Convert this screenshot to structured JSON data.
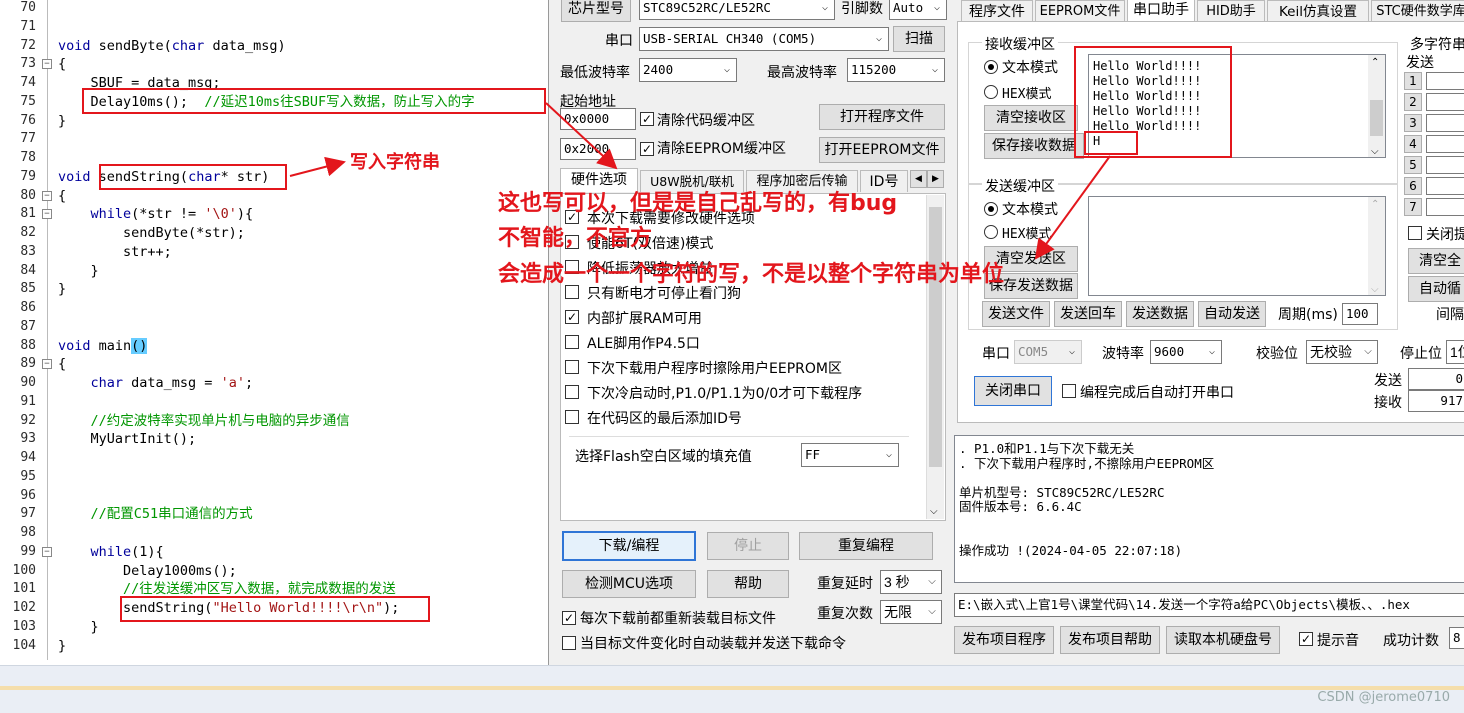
{
  "editor": {
    "lines": [
      {
        "n": "70",
        "html": ""
      },
      {
        "n": "71",
        "html": ""
      },
      {
        "n": "72",
        "html": "<span class='kw'>void</span> sendByte(<span class='kw'>char</span> data_msg)"
      },
      {
        "n": "73",
        "html": "{",
        "fold": "-"
      },
      {
        "n": "74",
        "html": "    SBUF = data_msg;"
      },
      {
        "n": "75",
        "html": "    Delay10ms();  <span class='cm'>//延迟10ms往SBUF写入数据，防止写入的字</span>"
      },
      {
        "n": "76",
        "html": "}"
      },
      {
        "n": "77",
        "html": ""
      },
      {
        "n": "78",
        "html": ""
      },
      {
        "n": "79",
        "html": "<span class='kw'>void</span> sendString(<span class='kw'>char</span>* str)"
      },
      {
        "n": "80",
        "html": "{",
        "fold": "-"
      },
      {
        "n": "81",
        "html": "    <span class='kw'>while</span>(*str != <span class='str'>'\\0'</span>){",
        "fold": "-"
      },
      {
        "n": "82",
        "html": "        sendByte(*str);"
      },
      {
        "n": "83",
        "html": "        str++;"
      },
      {
        "n": "84",
        "html": "    }"
      },
      {
        "n": "85",
        "html": "}"
      },
      {
        "n": "86",
        "html": ""
      },
      {
        "n": "87",
        "html": ""
      },
      {
        "n": "88",
        "html": "<span class='kw'>void</span> main<span class='hl'>()</span>"
      },
      {
        "n": "89",
        "html": "{",
        "fold": "-"
      },
      {
        "n": "90",
        "html": "    <span class='kw'>char</span> data_msg = <span class='str'>'a'</span>;"
      },
      {
        "n": "91",
        "html": ""
      },
      {
        "n": "92",
        "html": "    <span class='cm'>//约定波特率实现单片机与电脑的异步通信</span>"
      },
      {
        "n": "93",
        "html": "    MyUartInit();"
      },
      {
        "n": "94",
        "html": ""
      },
      {
        "n": "95",
        "html": ""
      },
      {
        "n": "96",
        "html": ""
      },
      {
        "n": "97",
        "html": "    <span class='cm'>//配置C51串口通信的方式</span>"
      },
      {
        "n": "98",
        "html": ""
      },
      {
        "n": "99",
        "html": "    <span class='kw'>while</span>(1){",
        "fold": "-"
      },
      {
        "n": "100",
        "html": "        Delay1000ms();"
      },
      {
        "n": "101",
        "html": "        <span class='cm'>//往发送缓冲区写入数据，就完成数据的发送</span>"
      },
      {
        "n": "102",
        "html": "        sendString(<span class='str'>\"Hello World!!!!\\r\\n\"</span>);"
      },
      {
        "n": "103",
        "html": "    }"
      },
      {
        "n": "104",
        "html": "}"
      }
    ]
  },
  "isp": {
    "chip_label": "芯片型号",
    "chip_value": "STC89C52RC/LE52RC",
    "pins_label": "引脚数",
    "pins_value": "Auto",
    "port_label": "串口",
    "port_value": "USB-SERIAL CH340 (COM5)",
    "scan_btn": "扫描",
    "min_baud_label": "最低波特率",
    "min_baud_value": "2400",
    "max_baud_label": "最高波特率",
    "max_baud_value": "115200",
    "start_addr_label": "起始地址",
    "addr1": "0x0000",
    "addr2": "0x2000",
    "clear_code": "清除代码缓冲区",
    "clear_eeprom": "清除EEPROM缓冲区",
    "open_prog": "打开程序文件",
    "open_eeprom": "打开EEPROM文件",
    "left_tabs": [
      "硬件选项",
      "U8W脱机/联机",
      "程序加密后传输",
      "ID号"
    ],
    "options": [
      {
        "label": "本次下载需要修改硬件选项",
        "checked": true
      },
      {
        "label": "使能6T(双倍速)模式",
        "checked": false
      },
      {
        "label": "降低振荡器放大增益",
        "checked": false
      },
      {
        "label": "只有断电才可停止看门狗",
        "checked": false
      },
      {
        "label": "内部扩展RAM可用",
        "checked": true
      },
      {
        "label": "ALE脚用作P4.5口",
        "checked": false
      },
      {
        "label": "下次下载用户程序时擦除用户EEPROM区",
        "checked": false
      },
      {
        "label": "下次冷启动时,P1.0/P1.1为0/0才可下载程序",
        "checked": false
      },
      {
        "label": "在代码区的最后添加ID号",
        "checked": false
      }
    ],
    "fill_label": "选择Flash空白区域的填充值",
    "fill_value": "FF",
    "download_btn": "下载/编程",
    "stop_btn": "停止",
    "reprog_btn": "重复编程",
    "check_mcu_btn": "检测MCU选项",
    "help_btn": "帮助",
    "repeat_delay_label": "重复延时",
    "repeat_delay_value": "3 秒",
    "repeat_count_label": "重复次数",
    "repeat_count_value": "无限",
    "reload_before": "每次下载前都重新装载目标文件",
    "auto_load": "当目标文件变化时自动装载并发送下载命令",
    "right_tabs": [
      "程序文件",
      "EEPROM文件",
      "串口助手",
      "HID助手",
      "Keil仿真设置",
      "STC硬件数学库"
    ],
    "recv_title": "接收缓冲区",
    "text_mode": "文本模式",
    "hex_mode": "HEX模式",
    "clear_recv": "清空接收区",
    "save_recv": "保存接收数据",
    "recv_lines": [
      "Hello World!!!!",
      "Hello World!!!!",
      "Hello World!!!!",
      "Hello World!!!!",
      "Hello World!!!!",
      "H"
    ],
    "send_title": "发送缓冲区",
    "clear_send": "清空发送区",
    "save_send": "保存发送数据",
    "send_file": "发送文件",
    "send_return": "发送回车",
    "send_data": "发送数据",
    "auto_send": "自动发送",
    "period_label": "周期(ms)",
    "period_value": "100",
    "multi_title": "多字符串",
    "multi_send": "发送",
    "multi_rows": [
      "1",
      "2",
      "3",
      "4",
      "5",
      "6",
      "7"
    ],
    "close_hint": "关闭提",
    "clear_all": "清空全",
    "auto_loop": "自动循",
    "interval": "间隔",
    "com_label": "串口",
    "com_value": "COM5",
    "baud_label": "波特率",
    "baud_value": "9600",
    "parity_label": "校验位",
    "parity_value": "无校验",
    "stopbit_label": "停止位",
    "stopbit_value": "1位",
    "close_port": "关闭串口",
    "auto_open": "编程完成后自动打开串口",
    "send_count_label": "发送",
    "send_count": "0",
    "recv_count_label": "接收",
    "recv_count": "917",
    "log_lines": [
      ". P1.0和P1.1与下次下载无关",
      ". 下次下载用户程序时,不擦除用户EEPROM区",
      "",
      "单片机型号: STC89C52RC/LE52RC",
      "固件版本号: 6.6.4C",
      "",
      "",
      "操作成功 !(2024-04-05 22:07:18)"
    ],
    "path": "E:\\嵌入式\\上官1号\\课堂代码\\14.发送一个字符a给PC\\Objects\\模板、、.hex",
    "publish_prog": "发布项目程序",
    "publish_help": "发布项目帮助",
    "read_disk": "读取本机硬盘号",
    "beep": "提示音",
    "success_count_label": "成功计数",
    "success_count": "8"
  },
  "annotations": {
    "write_string": "写入字符串",
    "line1": "这也写可以，但是是自己乱写的，有bug",
    "line2": "不智能，不官方",
    "line3": "会造成一个一个字符的写，不是以整个字符串为单位"
  },
  "footer": {
    "watermark": "CSDN @jerome0710"
  },
  "colors": {
    "annotation": "#e3161c",
    "keyword": "#00009b",
    "comment": "#009600",
    "string": "#a31515"
  }
}
